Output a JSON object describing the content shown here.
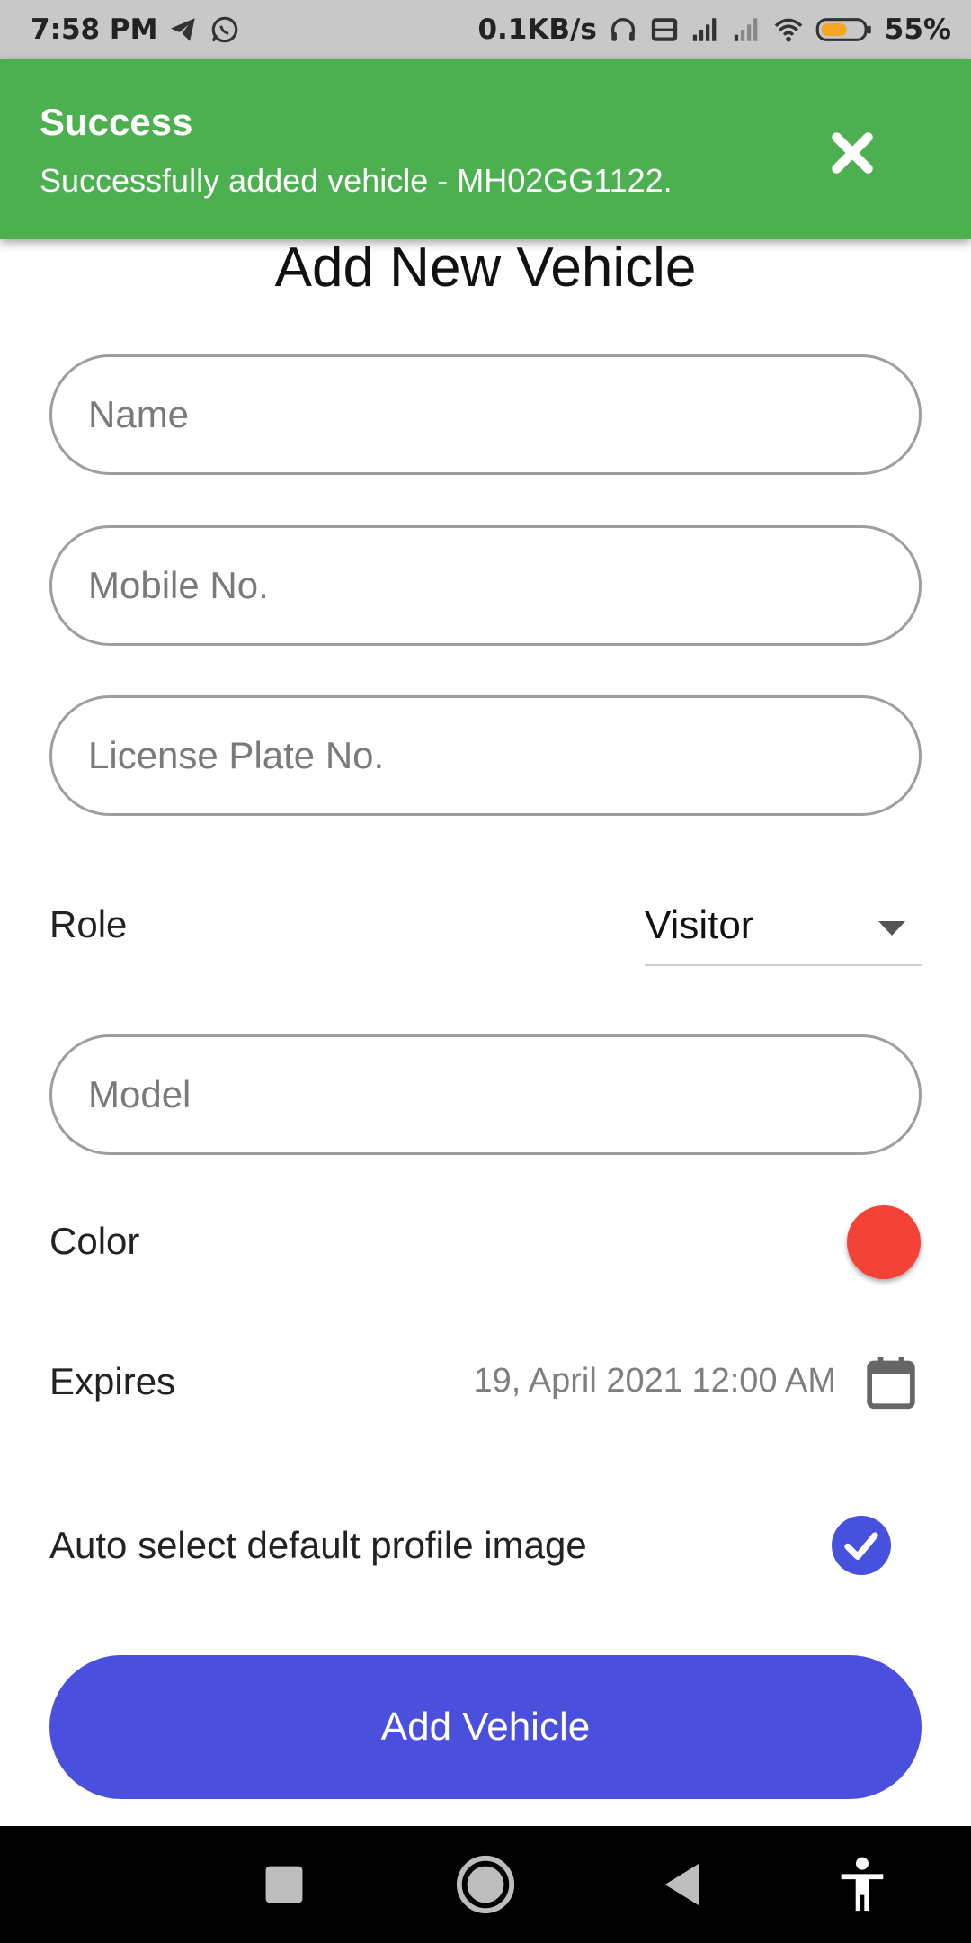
{
  "status_bar": {
    "time": "7:58 PM",
    "net_speed": "0.1KB/s",
    "battery": "55%",
    "icons": [
      "telegram-icon",
      "whatsapp-icon",
      "headphones-icon",
      "volte-icon",
      "signal-icon",
      "signal-weak-icon",
      "wifi-icon",
      "battery-icon"
    ]
  },
  "toast": {
    "title": "Success",
    "message": "Successfully added vehicle - MH02GG1122.",
    "close_icon": "close-icon",
    "color": "#4caf50"
  },
  "form": {
    "title": "Add New Vehicle",
    "name_placeholder": "Name",
    "mobile_placeholder": "Mobile No.",
    "plate_placeholder": "License Plate No.",
    "role_label": "Role",
    "role_value": "Visitor",
    "model_placeholder": "Model",
    "color_label": "Color",
    "color_value": "#f44336",
    "expires_label": "Expires",
    "expires_value": "19, April 2021 12:00 AM",
    "auto_image_label": "Auto select default profile image",
    "auto_image_checked": true,
    "submit_label": "Add Vehicle",
    "accent": "#4a50dd"
  },
  "nav": {
    "items": [
      "recents-square-icon",
      "home-circle-icon",
      "back-triangle-icon",
      "accessibility-icon"
    ]
  }
}
